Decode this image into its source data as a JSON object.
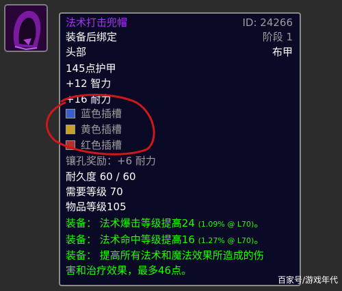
{
  "item": {
    "name": "法术打击兜帽",
    "id_text": "ID: 24266",
    "binding": "装备后绑定",
    "phase": "阶段 1",
    "slot": "头部",
    "armor_type": "布甲",
    "armor": "145点护甲",
    "stat_int": "+12 智力",
    "stat_sta": "+16 耐力",
    "sockets": [
      {
        "label": "蓝色插槽",
        "icon": "blue-socket-icon",
        "color": "#3a5fcd"
      },
      {
        "label": "黄色插槽",
        "icon": "yellow-socket-icon",
        "color": "#c8a028"
      },
      {
        "label": "红色插槽",
        "icon": "red-socket-icon",
        "color": "#b03030"
      }
    ],
    "socket_bonus": "镶孔奖励：+6 耐力",
    "durability": "耐久度 60 / 60",
    "required_level": "需要等级 70",
    "item_level": "物品等级105",
    "equip1_main": "装备： 法术爆击等级提高24",
    "equip1_note": "(1.09% @ L70)",
    "equip1_end": "。",
    "equip2_main": "装备： 法术命中等级提高16",
    "equip2_note": "(1.27% @ L70)",
    "equip2_end": "。",
    "equip3_line1": "装备： 提高所有法术和魔法效果所造成的伤",
    "equip3_line2": "害和治疗效果，最多46点。"
  },
  "icon": "purple-hood-icon",
  "watermark": "百家号/游戏年代",
  "colors": {
    "epic": "#a335ee",
    "green": "#1eff00",
    "grey": "#9d9d9d",
    "annotation": "#d01818"
  }
}
